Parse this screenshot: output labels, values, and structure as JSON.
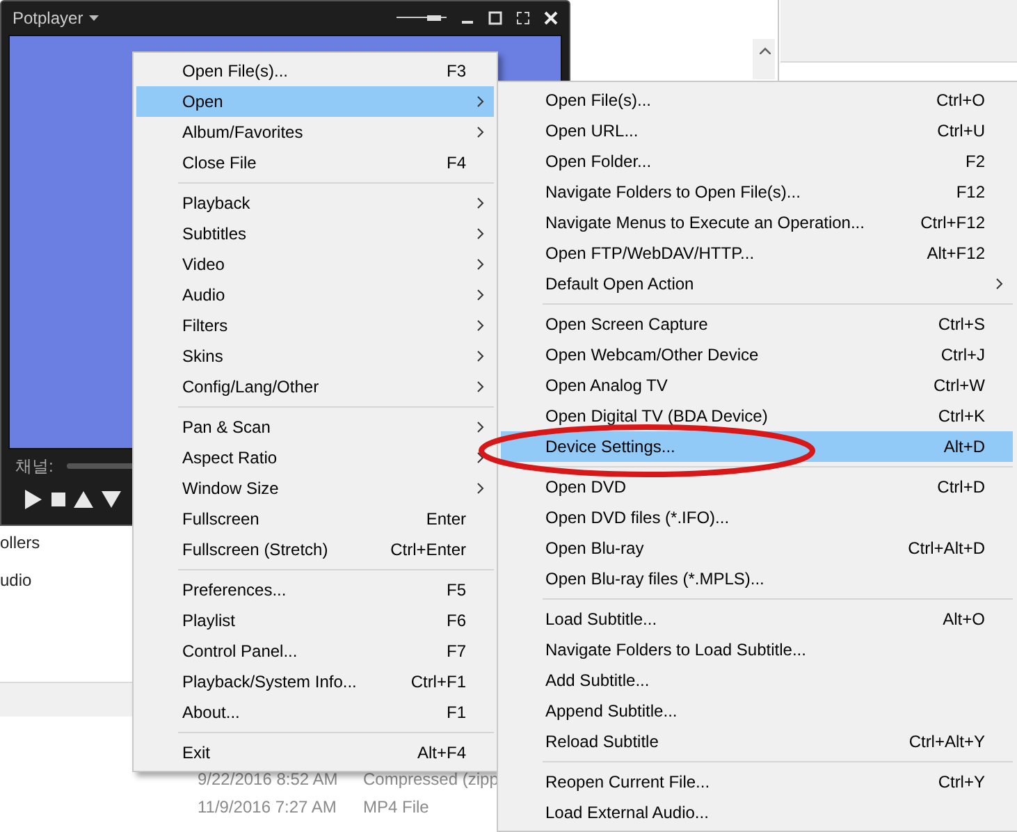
{
  "player": {
    "title": "Potplayer",
    "channel_label": "채널:",
    "opacity": {
      "level": 0.85
    }
  },
  "background": {
    "list_fragments": [
      "ollers",
      "udio"
    ],
    "rows": [
      {
        "date": "9/22/2016 8:52 AM",
        "type": "Compressed (zipp"
      },
      {
        "date": "11/9/2016 7:27 AM",
        "type": "MP4 File"
      }
    ]
  },
  "menu": {
    "items": [
      {
        "kind": "item",
        "label": "Open File(s)...",
        "shortcut": "F3",
        "submenu": false,
        "selected": false
      },
      {
        "kind": "item",
        "label": "Open",
        "submenu": true,
        "selected": true
      },
      {
        "kind": "item",
        "label": "Album/Favorites",
        "submenu": true,
        "selected": false
      },
      {
        "kind": "item",
        "label": "Close File",
        "shortcut": "F4",
        "submenu": false,
        "selected": false
      },
      {
        "kind": "separator"
      },
      {
        "kind": "item",
        "label": "Playback",
        "submenu": true,
        "selected": false
      },
      {
        "kind": "item",
        "label": "Subtitles",
        "submenu": true,
        "selected": false
      },
      {
        "kind": "item",
        "label": "Video",
        "submenu": true,
        "selected": false
      },
      {
        "kind": "item",
        "label": "Audio",
        "submenu": true,
        "selected": false
      },
      {
        "kind": "item",
        "label": "Filters",
        "submenu": true,
        "selected": false
      },
      {
        "kind": "item",
        "label": "Skins",
        "submenu": true,
        "selected": false
      },
      {
        "kind": "item",
        "label": "Config/Lang/Other",
        "submenu": true,
        "selected": false
      },
      {
        "kind": "separator"
      },
      {
        "kind": "item",
        "label": "Pan & Scan",
        "submenu": true,
        "selected": false
      },
      {
        "kind": "item",
        "label": "Aspect Ratio",
        "submenu": true,
        "selected": false
      },
      {
        "kind": "item",
        "label": "Window Size",
        "submenu": true,
        "selected": false
      },
      {
        "kind": "item",
        "label": "Fullscreen",
        "shortcut": "Enter",
        "submenu": false,
        "selected": false
      },
      {
        "kind": "item",
        "label": "Fullscreen (Stretch)",
        "shortcut": "Ctrl+Enter",
        "submenu": false,
        "selected": false
      },
      {
        "kind": "separator"
      },
      {
        "kind": "item",
        "label": "Preferences...",
        "shortcut": "F5",
        "submenu": false,
        "selected": false
      },
      {
        "kind": "item",
        "label": "Playlist",
        "shortcut": "F6",
        "submenu": false,
        "selected": false
      },
      {
        "kind": "item",
        "label": "Control Panel...",
        "shortcut": "F7",
        "submenu": false,
        "selected": false
      },
      {
        "kind": "item",
        "label": "Playback/System Info...",
        "shortcut": "Ctrl+F1",
        "submenu": false,
        "selected": false
      },
      {
        "kind": "item",
        "label": "About...",
        "shortcut": "F1",
        "submenu": false,
        "selected": false
      },
      {
        "kind": "separator"
      },
      {
        "kind": "item",
        "label": "Exit",
        "shortcut": "Alt+F4",
        "submenu": false,
        "selected": false
      }
    ]
  },
  "submenu": {
    "items": [
      {
        "kind": "item",
        "label": "Open File(s)...",
        "shortcut": "Ctrl+O",
        "submenu": false,
        "selected": false
      },
      {
        "kind": "item",
        "label": "Open URL...",
        "shortcut": "Ctrl+U",
        "submenu": false,
        "selected": false
      },
      {
        "kind": "item",
        "label": "Open Folder...",
        "shortcut": "F2",
        "submenu": false,
        "selected": false
      },
      {
        "kind": "item",
        "label": "Navigate Folders to Open File(s)...",
        "shortcut": "F12",
        "submenu": false,
        "selected": false
      },
      {
        "kind": "item",
        "label": "Navigate Menus to Execute an Operation...",
        "shortcut": "Ctrl+F12",
        "submenu": false,
        "selected": false
      },
      {
        "kind": "item",
        "label": "Open FTP/WebDAV/HTTP...",
        "shortcut": "Alt+F12",
        "submenu": false,
        "selected": false
      },
      {
        "kind": "item",
        "label": "Default Open Action",
        "submenu": true,
        "selected": false
      },
      {
        "kind": "separator"
      },
      {
        "kind": "item",
        "label": "Open Screen Capture",
        "shortcut": "Ctrl+S",
        "submenu": false,
        "selected": false
      },
      {
        "kind": "item",
        "label": "Open Webcam/Other Device",
        "shortcut": "Ctrl+J",
        "submenu": false,
        "selected": false
      },
      {
        "kind": "item",
        "label": "Open Analog TV",
        "shortcut": "Ctrl+W",
        "submenu": false,
        "selected": false
      },
      {
        "kind": "item",
        "label": "Open Digital TV (BDA Device)",
        "shortcut": "Ctrl+K",
        "submenu": false,
        "selected": false
      },
      {
        "kind": "item",
        "label": "Device Settings...",
        "shortcut": "Alt+D",
        "submenu": false,
        "selected": true
      },
      {
        "kind": "separator"
      },
      {
        "kind": "item",
        "label": "Open DVD",
        "shortcut": "Ctrl+D",
        "submenu": false,
        "selected": false
      },
      {
        "kind": "item",
        "label": "Open DVD files (*.IFO)...",
        "submenu": false,
        "selected": false
      },
      {
        "kind": "item",
        "label": "Open Blu-ray",
        "shortcut": "Ctrl+Alt+D",
        "submenu": false,
        "selected": false
      },
      {
        "kind": "item",
        "label": "Open Blu-ray files (*.MPLS)...",
        "submenu": false,
        "selected": false
      },
      {
        "kind": "separator"
      },
      {
        "kind": "item",
        "label": "Load Subtitle...",
        "shortcut": "Alt+O",
        "submenu": false,
        "selected": false
      },
      {
        "kind": "item",
        "label": "Navigate Folders to Load Subtitle...",
        "submenu": false,
        "selected": false
      },
      {
        "kind": "item",
        "label": "Add Subtitle...",
        "submenu": false,
        "selected": false
      },
      {
        "kind": "item",
        "label": "Append Subtitle...",
        "submenu": false,
        "selected": false
      },
      {
        "kind": "item",
        "label": "Reload Subtitle",
        "shortcut": "Ctrl+Alt+Y",
        "submenu": false,
        "selected": false
      },
      {
        "kind": "separator"
      },
      {
        "kind": "item",
        "label": "Reopen Current File...",
        "shortcut": "Ctrl+Y",
        "submenu": false,
        "selected": false
      },
      {
        "kind": "item",
        "label": "Load External Audio...",
        "submenu": false,
        "selected": false
      }
    ]
  }
}
